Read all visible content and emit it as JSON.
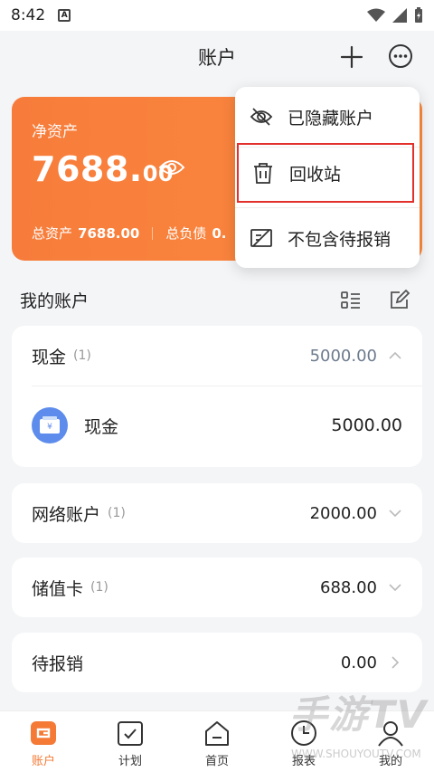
{
  "status": {
    "time": "8:42",
    "notif": "A"
  },
  "header": {
    "title": "账户",
    "add_icon": "plus-icon",
    "more_icon": "more-icon"
  },
  "asset": {
    "label": "净资产",
    "value_int": "7688.",
    "value_dec": "00",
    "total_assets_label": "总资产",
    "total_assets": "7688.00",
    "total_debt_label": "总负债",
    "total_debt": "0.",
    "color_start": "#f77c3b",
    "color_end": "#fb8a3e"
  },
  "popup": {
    "items": [
      {
        "label": "已隐藏账户",
        "icon": "eye-off-icon"
      },
      {
        "label": "回收站",
        "icon": "trash-icon"
      },
      {
        "label": "不包含待报销",
        "icon": "receipt-off-icon"
      }
    ]
  },
  "section": {
    "title": "我的账户"
  },
  "accounts": [
    {
      "name": "现金",
      "count": "(1)",
      "amount": "5000.00",
      "expanded": true,
      "children": [
        {
          "name": "现金",
          "amount": "5000.00",
          "icon": "cash-icon"
        }
      ]
    },
    {
      "name": "网络账户",
      "count": "(1)",
      "amount": "2000.00",
      "expanded": false
    },
    {
      "name": "储值卡",
      "count": "(1)",
      "amount": "688.00",
      "expanded": false
    },
    {
      "name": "待报销",
      "count": "",
      "amount": "0.00",
      "expanded": false
    }
  ],
  "tabs": [
    {
      "label": "账户",
      "icon": "wallet-icon",
      "active": true
    },
    {
      "label": "计划",
      "icon": "checkbox-icon",
      "active": false
    },
    {
      "label": "首页",
      "icon": "home-icon",
      "active": false
    },
    {
      "label": "报表",
      "icon": "clock-icon",
      "active": false
    },
    {
      "label": "我的",
      "icon": "user-icon",
      "active": false
    }
  ],
  "watermark": {
    "text": "手游TV",
    "sub": "WWW.SHOUYOUTV.COM"
  },
  "accent": "#f47a36",
  "highlight_border": "#e2302c"
}
